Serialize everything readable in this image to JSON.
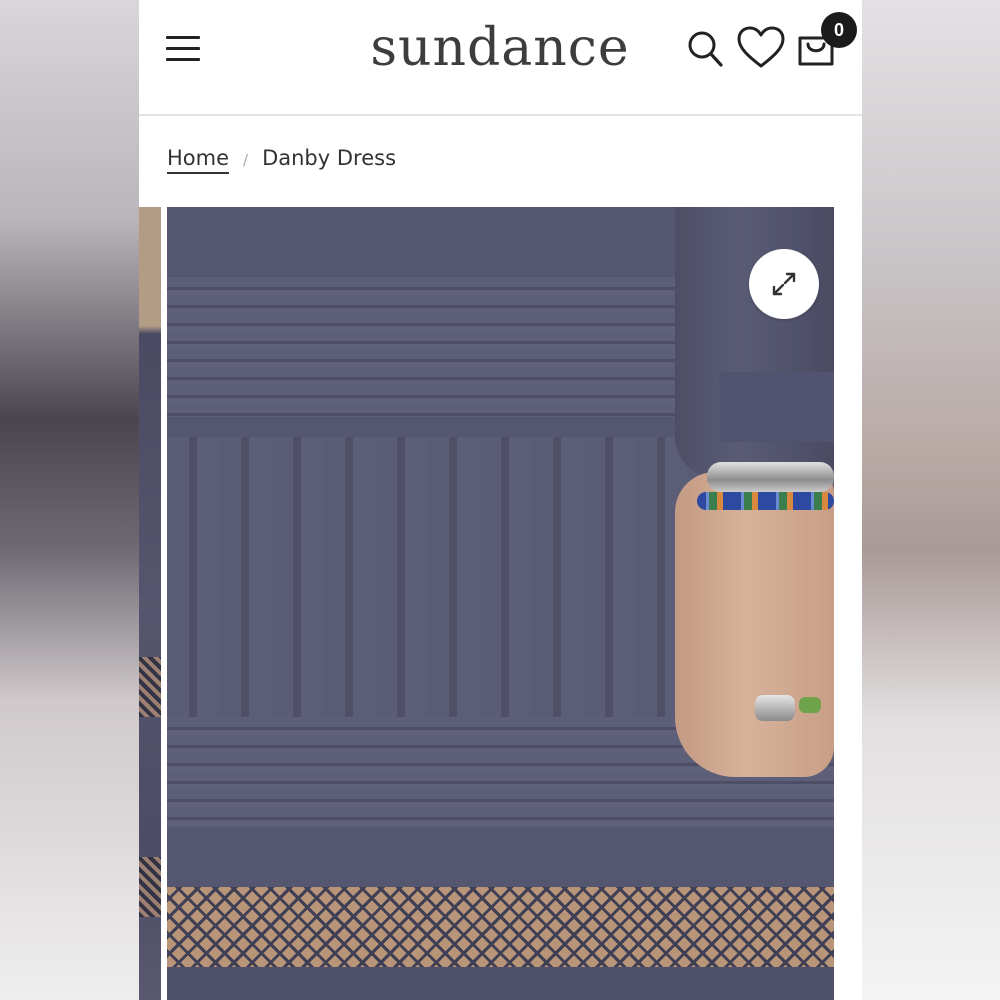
{
  "header": {
    "brand": "sundance",
    "menu_icon": "hamburger-menu-icon",
    "search_icon": "search-icon",
    "wishlist_icon": "heart-icon",
    "cart_icon": "shopping-bag-icon",
    "cart_count": "0"
  },
  "breadcrumb": {
    "home_label": "Home",
    "separator": "/",
    "current_label": "Danby Dress"
  },
  "gallery": {
    "expand_icon": "expand-arrows-icon",
    "image_subject": "navy pintucked tiered dress with lace bands, hand with silver cuff and beaded bracelets"
  },
  "colors": {
    "dress": "#55566f",
    "lace_background": "#b89478",
    "badge": "#1b1b1b"
  }
}
